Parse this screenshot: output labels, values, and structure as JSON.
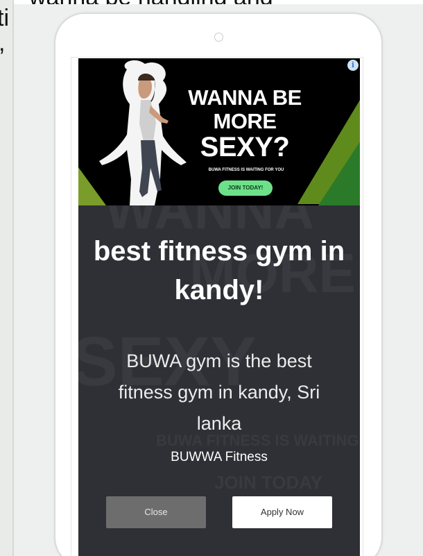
{
  "background_page": {
    "text_top": "wanna be handling and",
    "text_left_1": "ti",
    "text_left_2": ","
  },
  "ad": {
    "headline_1": "WANNA BE",
    "headline_2": "MORE",
    "headline_3": "SEXY?",
    "tagline": "BUWA FITNESS IS WAITING FOR YOU",
    "cta": "JOIN TODAY!",
    "info_icon": "i",
    "colors": {
      "accent_green": "#6de18a",
      "triangle_green": "#5f8b1c"
    }
  },
  "ghost_text": {
    "line1": "WANNA",
    "line2": "MORE",
    "line3": "SEXY",
    "line4": "BUWA FITNESS IS WAITING",
    "line5": "JOIN TODAY"
  },
  "popup": {
    "title": "best fitness gym in kandy!",
    "description": "BUWA gym is the best fitness gym in kandy, Sri lanka",
    "brand": "BUWWA Fitness",
    "close_label": "Close",
    "apply_label": "Apply Now",
    "colors": {
      "panel_bg": "#2e3035",
      "close_bg": "#6d6d6d",
      "apply_bg": "#ffffff"
    }
  }
}
